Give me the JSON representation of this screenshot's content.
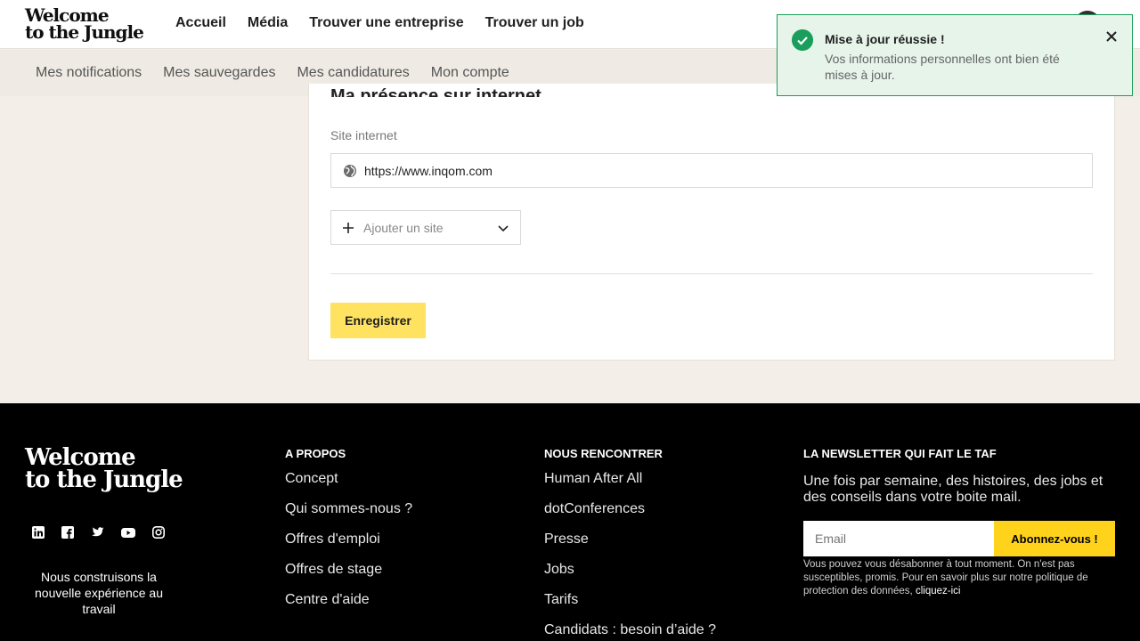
{
  "header": {
    "logo_line1": "Welcome",
    "logo_line2": "to the Jungle",
    "nav": [
      "Accueil",
      "Média",
      "Trouver une entreprise",
      "Trouver un job"
    ]
  },
  "subnav": [
    "Mes notifications",
    "Mes sauvegardes",
    "Mes candidatures",
    "Mon compte"
  ],
  "form": {
    "section_title": "Ma présence sur internet",
    "site_label": "Site internet",
    "site_value": "https://www.inqom.com",
    "add_site_label": "Ajouter un site",
    "save_label": "Enregistrer"
  },
  "toast": {
    "title": "Mise à jour réussie !",
    "message": "Vos informations personnelles ont bien été mises à jour."
  },
  "footer": {
    "logo_line1": "Welcome",
    "logo_line2": "to the Jungle",
    "tagline": "Nous construisons la nouvelle expérience au travail",
    "socials": [
      "linkedin-icon",
      "facebook-icon",
      "twitter-icon",
      "youtube-icon",
      "instagram-icon"
    ],
    "col_apropos": {
      "title": "A PROPOS",
      "links": [
        "Concept",
        "Qui sommes-nous ?",
        "Offres d'emploi",
        "Offres de stage",
        "Centre d'aide"
      ]
    },
    "col_rencontrer": {
      "title": "NOUS RENCONTRER",
      "links": [
        "Human After All",
        "dotConferences",
        "Presse",
        "Jobs",
        "Tarifs",
        "Candidats : besoin d’aide ?"
      ]
    },
    "newsletter": {
      "title": "LA NEWSLETTER QUI FAIT LE TAF",
      "text": "Une fois par semaine, des histoires, des jobs et des conseils dans votre boite mail.",
      "email_placeholder": "Email",
      "subscribe_label": "Abonnez-vous !",
      "legal": "Vous pouvez vous désabonner à tout moment. On n'est pas susceptibles, promis. Pour en savoir plus sur notre politique de protection des données,",
      "legal_link": "cliquez-ici"
    }
  },
  "colors": {
    "accent_yellow": "#ffe260",
    "success_green": "#1a9e5b",
    "footer_bg": "#000000",
    "page_bg": "#f3efe8"
  }
}
